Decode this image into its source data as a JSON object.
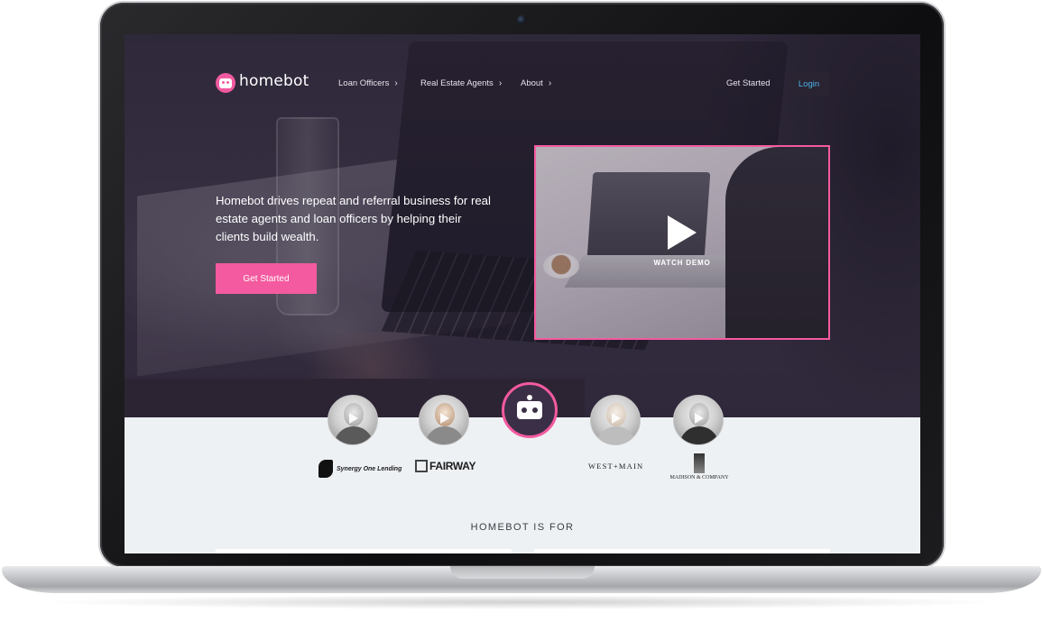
{
  "nav": {
    "logo_text": "homebot",
    "items": [
      {
        "label": "Loan Officers"
      },
      {
        "label": "Real Estate Agents"
      },
      {
        "label": "About"
      }
    ],
    "get_started": "Get Started",
    "login": "Login"
  },
  "hero": {
    "headline": "Homebot drives repeat and referral business for real estate agents and loan officers by helping their clients build wealth.",
    "cta": "Get Started",
    "video_label": "WATCH DEMO"
  },
  "partners": [
    {
      "name": "Synergy One Lending"
    },
    {
      "name": "FAIRWAY"
    },
    {
      "name": "WEST+MAIN"
    },
    {
      "name": "MADISON & COMPANY"
    }
  ],
  "section": {
    "title": "HOMEBOT IS FOR"
  },
  "colors": {
    "accent": "#f45a9f",
    "hero_dark": "#3a3447",
    "login_text": "#4ab3e8"
  }
}
